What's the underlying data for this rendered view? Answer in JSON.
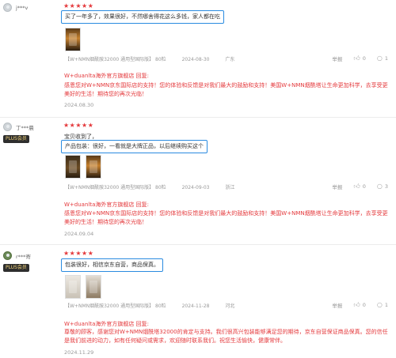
{
  "reviews": [
    {
      "user": "j***v",
      "has_plus": false,
      "stars": "★★★★★",
      "content": "买了一年多了，效果很好，不然哪舍得花这么多钱，家人都在吃",
      "pre_line": "",
      "meta": {
        "product": "【W+NMN烟酰胺32000 通用型国际版】 80粒",
        "date": "2024-08-30",
        "location": "广东"
      },
      "actions": {
        "report": "举报",
        "likes": "0",
        "comments": "1"
      },
      "reply": {
        "head": "W+duanlta海外官方旗舰店 回复:",
        "body": "感恩您对W+NMN京东国际店的支持！您的体验和反馈是对我们最大的鼓励和支持！美国W+NMN烟酰塔让生命更加科学，去享受更美好的生活！期待您的再次光临！",
        "date": "2024.08.30"
      }
    },
    {
      "user": "丁***晨",
      "has_plus": true,
      "plus_label": "PLUS会员",
      "stars": "★★★★★",
      "pre_line": "宝贝收到了，",
      "content": "产品包装：很好，一看就是大牌正品，以后继续购买这个",
      "meta": {
        "product": "【W+NMN烟酰胺32000 通用型国际版】 80粒",
        "date": "2024-09-03",
        "location": "浙江"
      },
      "actions": {
        "report": "举报",
        "likes": "0",
        "comments": "3"
      },
      "reply": {
        "head": "W+duanlta海外官方旗舰店 回复:",
        "body": "感恩您对W+NMN京东国际店的支持！您的体验和反馈是对我们最大的鼓励和支持！美国W+NMN烟酰塔让生命更加科学，去享受更美好的生活！期待您的再次光临！",
        "date": "2024.09.04"
      }
    },
    {
      "user": "r***寄",
      "has_plus": true,
      "plus_label": "PLUS会员",
      "stars": "★★★★★",
      "pre_line": "",
      "content": "包装很好，相信京东自营，商品保真。",
      "meta": {
        "product": "【W+NMN烟酰胺32000 通用型国际版】 80粒",
        "date": "2024-11-28",
        "location": "河北"
      },
      "actions": {
        "report": "举报",
        "likes": "0",
        "comments": "1"
      },
      "reply": {
        "head": "W+duanlta海外官方旗舰店 回复:",
        "body": "尊敬的顾客，感谢您对W+NMN烟酰塔32000的肯定与支持。我们很高兴包装能够满足您的期待，京东自营保证商品保真。您的信任是我们前进的动力，如有任何疑问或需求，欢迎随时联系我们。祝您生活愉快，健康常伴。",
        "date": "2024.11.29"
      }
    }
  ]
}
